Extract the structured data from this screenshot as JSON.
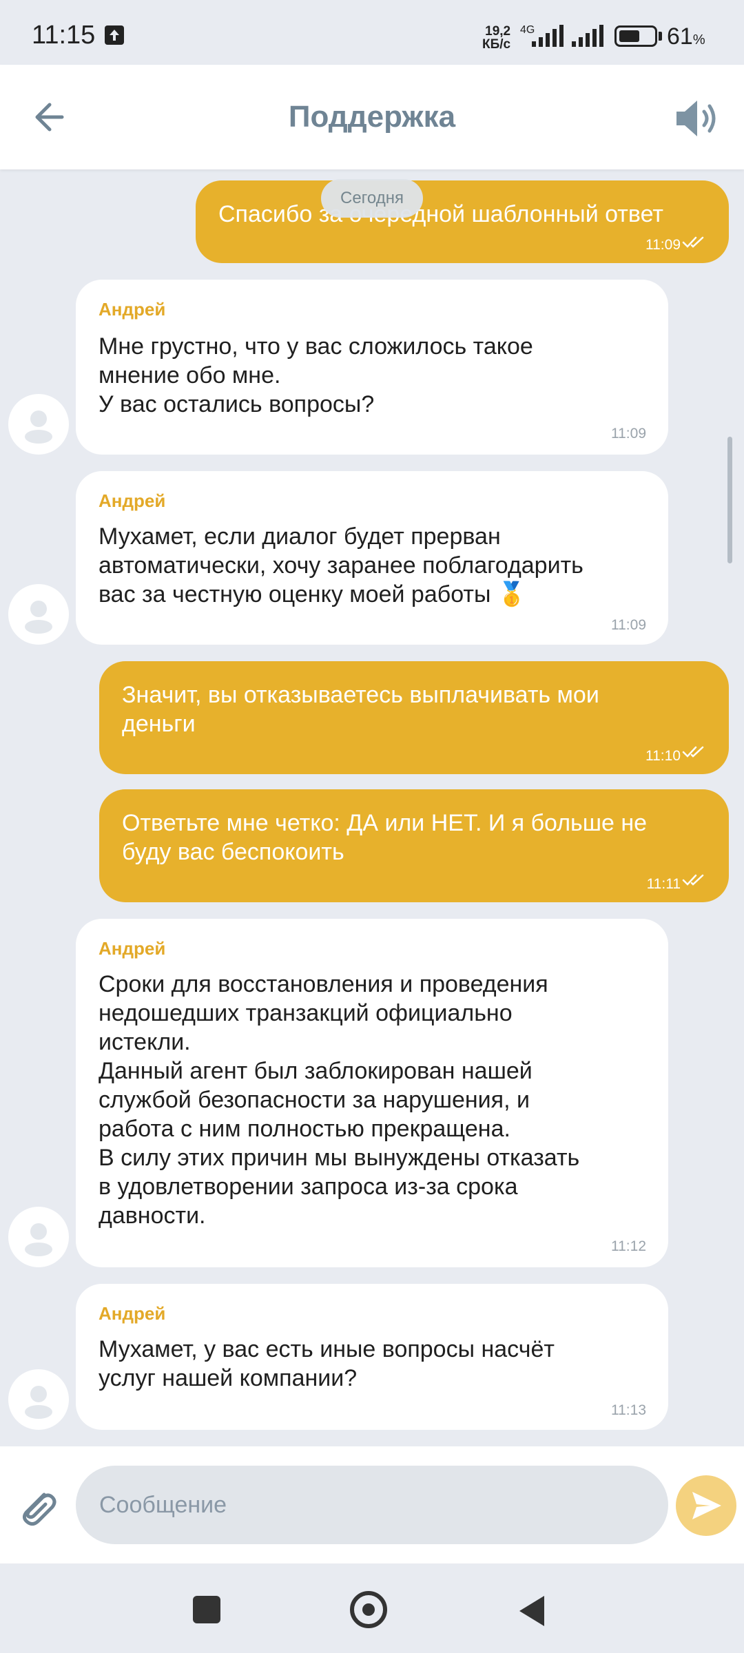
{
  "status_bar": {
    "time": "11:15",
    "net_speed_value": "19,2",
    "net_speed_unit": "КБ/с",
    "network_type": "4G",
    "battery_percent": "61",
    "battery_unit": "%",
    "battery_level": 0.61
  },
  "header": {
    "title": "Поддержка"
  },
  "chat": {
    "date_label": "Сегодня",
    "messages": [
      {
        "direction": "out",
        "text": "Спасибо за очередной шаблонный ответ",
        "time": "11:09"
      },
      {
        "direction": "in",
        "author": "Андрей",
        "text": "Мне грустно, что у вас сложилось такое\nмнение обо мне.\nУ вас остались вопросы?",
        "time": "11:09"
      },
      {
        "direction": "in",
        "author": "Андрей",
        "text": "Мухамет, если диалог будет прерван\nавтоматически, хочу заранее поблагодарить\nвас за честную оценку моей работы 🥇",
        "time": "11:09"
      },
      {
        "direction": "out",
        "text": "Значит, вы отказываетесь выплачивать мои\nденьги",
        "time": "11:10"
      },
      {
        "direction": "out",
        "text": "Ответьте мне четко: ДА или НЕТ. И я больше не\nбуду вас беспокоить",
        "time": "11:11"
      },
      {
        "direction": "in",
        "author": "Андрей",
        "text": "Сроки для восстановления и проведения\nнедошедших транзакций официально\nистекли.\nДанный агент был заблокирован нашей\nслужбой безопасности за нарушения, и\nработа с ним полностью прекращена.\nВ силу этих причин мы вынуждены отказать\nв удовлетворении запроса из-за срока\nдавности.",
        "time": "11:12"
      },
      {
        "direction": "in",
        "author": "Андрей",
        "text": "Мухамет, у вас есть иные вопросы насчёт\nуслуг нашей компании?",
        "time": "11:13"
      }
    ]
  },
  "composer": {
    "placeholder": "Сообщение"
  },
  "colors": {
    "accent": "#e7b12c",
    "header_title": "#6f8494",
    "background": "#e8ebf1"
  },
  "icons": [
    "upload-icon",
    "signal-icon",
    "battery-icon",
    "back-arrow-icon",
    "speaker-icon",
    "avatar-icon",
    "read-ticks-icon",
    "paperclip-icon",
    "send-icon",
    "recent-apps-icon",
    "home-icon",
    "nav-back-icon"
  ]
}
